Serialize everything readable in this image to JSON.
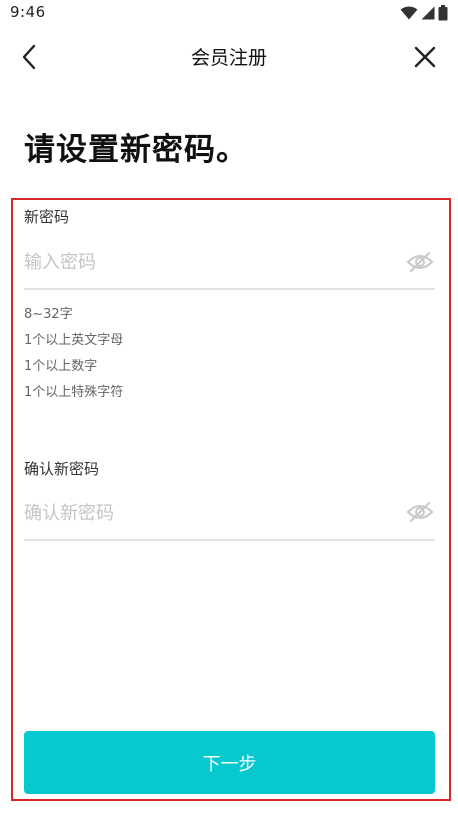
{
  "status_bar": {
    "time": "9:46",
    "icons": [
      "wifi-icon",
      "cellular-signal-icon",
      "battery-icon"
    ]
  },
  "nav": {
    "title": "会员注册",
    "back_icon": "chevron-left-icon",
    "close_icon": "close-icon"
  },
  "heading": "请设置新密码。",
  "new_password": {
    "label": "新密码",
    "placeholder": "输入密码",
    "value": "",
    "visibility_icon": "eye-off-icon"
  },
  "rules": [
    "8~32字",
    "1个以上英文字母",
    "1个以上数字",
    "1个以上特殊字符"
  ],
  "confirm_password": {
    "label": "确认新密码",
    "placeholder": "确认新密码",
    "value": "",
    "visibility_icon": "eye-off-icon"
  },
  "next_button": "下一步",
  "colors": {
    "accent": "#08c8cf",
    "highlight_border": "#d42a2a",
    "placeholder": "#c4c4c4"
  }
}
